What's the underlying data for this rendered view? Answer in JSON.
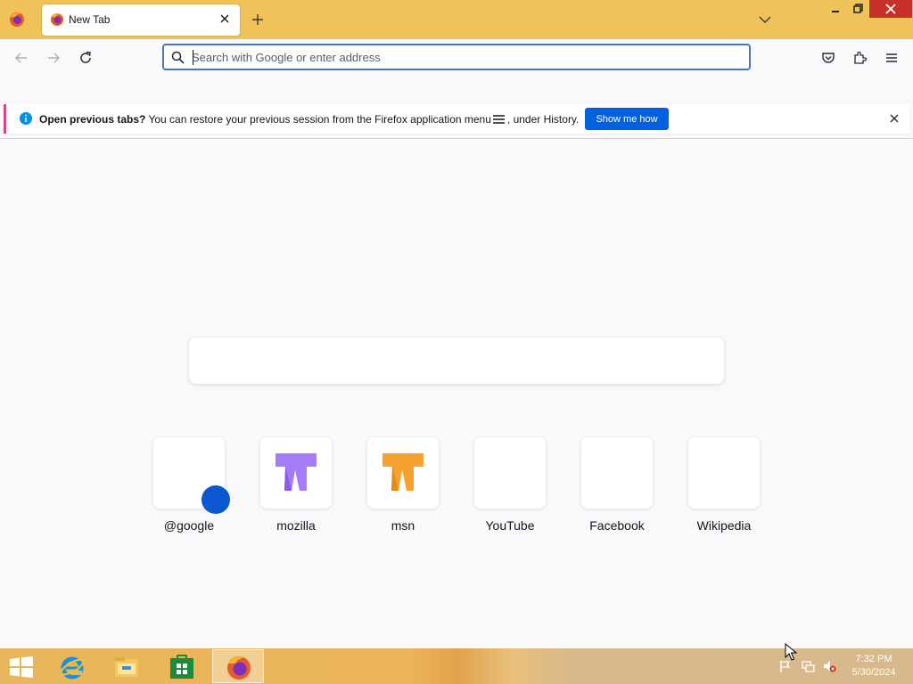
{
  "window": {
    "tab_title": "New Tab",
    "accent_color": "#f0c35a"
  },
  "urlbar": {
    "placeholder": "Search with Google or enter address"
  },
  "notification": {
    "bold_text": "Open previous tabs?",
    "text_before_icon": " You can restore your previous session from the Firefox application menu",
    "text_after_icon": ", under History.",
    "button_label": "Show me how"
  },
  "top_sites": [
    {
      "label": "@google",
      "icon": "google-dot"
    },
    {
      "label": "mozilla",
      "icon": "mozilla-logo",
      "color": "#a57cf7"
    },
    {
      "label": "msn",
      "icon": "msn-logo",
      "color": "#f6a231"
    },
    {
      "label": "YouTube",
      "icon": "blank"
    },
    {
      "label": "Facebook",
      "icon": "blank"
    },
    {
      "label": "Wikipedia",
      "icon": "blank"
    }
  ],
  "taskbar": {
    "apps": [
      "internet-explorer-icon",
      "file-explorer-icon",
      "store-icon",
      "firefox-icon"
    ],
    "clock_time": "7:32 PM",
    "clock_date": "5/30/2024"
  },
  "colors": {
    "primary_button": "#0061e0",
    "url_focus": "#4575c4",
    "close_button": "#c7302b"
  }
}
